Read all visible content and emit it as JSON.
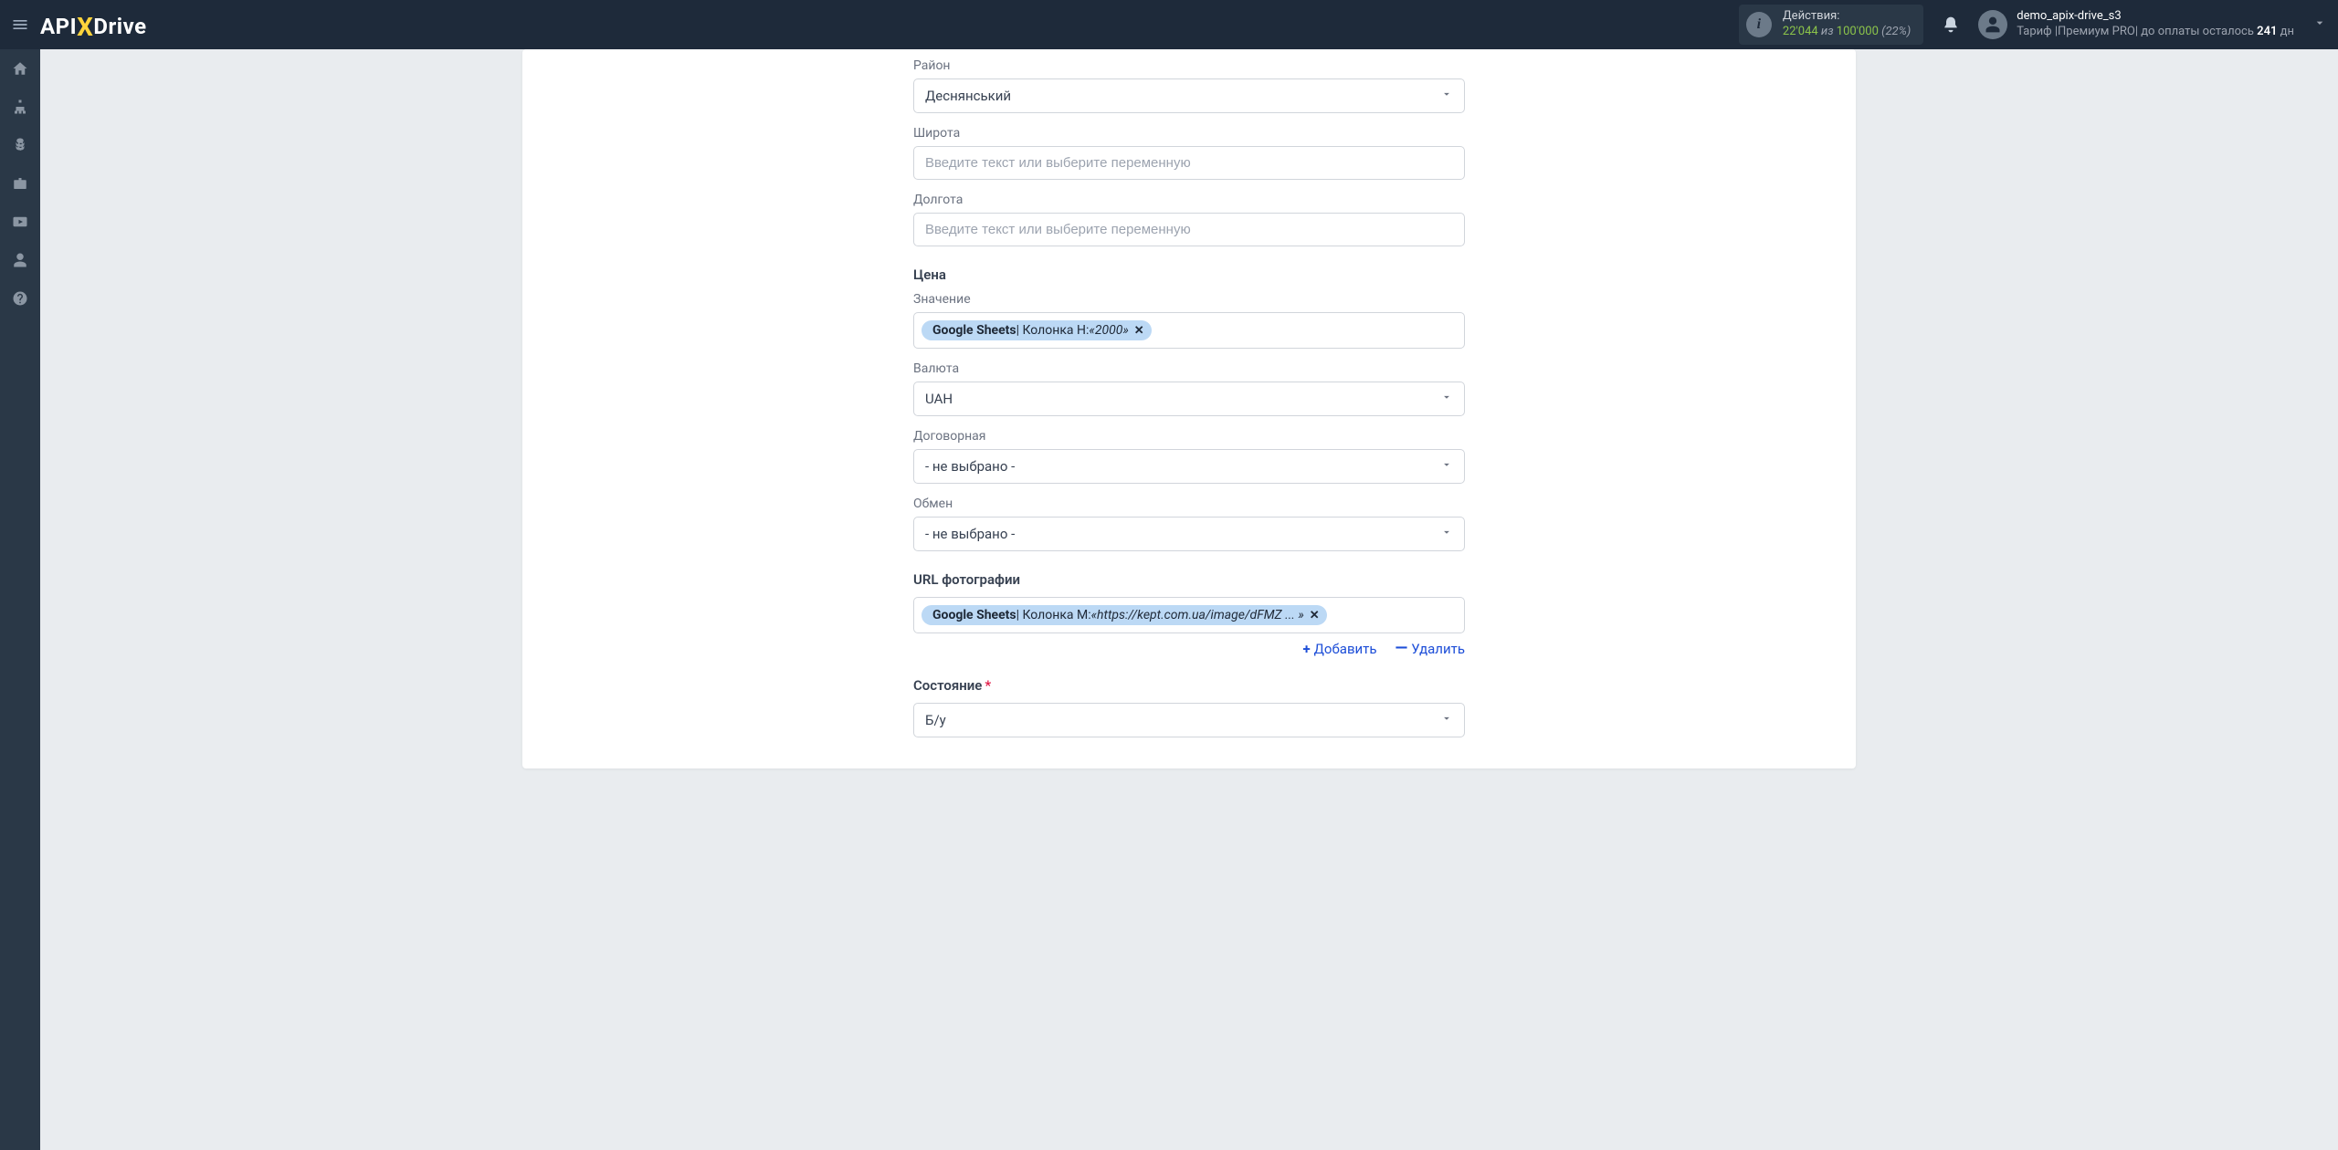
{
  "header": {
    "actions_label": "Действия:",
    "actions_current": "22'044",
    "actions_of": " из ",
    "actions_max": "100'000",
    "actions_pct": "(22%)",
    "user_name": "demo_apix-drive_s3",
    "tariff_prefix": "Тариф |",
    "tariff_name": "Премиум PRO",
    "tariff_mid": "| до оплаты осталось ",
    "tariff_days": "241",
    "tariff_suffix": " дн"
  },
  "form": {
    "district_label": "Район",
    "district_value": "Деснянський",
    "lat_label": "Широта",
    "lat_placeholder": "Введите текст или выберите переменную",
    "lon_label": "Долгота",
    "lon_placeholder": "Введите текст или выберите переменную",
    "price_section": "Цена",
    "value_label": "Значение",
    "value_tag_src": "Google Sheets",
    "value_tag_col": " | Колонка H: ",
    "value_tag_val": "«2000»",
    "currency_label": "Валюта",
    "currency_value": "UAH",
    "negotiable_label": "Договорная",
    "negotiable_value": "- не выбрано -",
    "exchange_label": "Обмен",
    "exchange_value": "- не выбрано -",
    "photo_section": "URL фотографии",
    "photo_tag_src": "Google Sheets",
    "photo_tag_col": " | Колонка M: ",
    "photo_tag_val": "«https://kept.com.ua/image/dFMZ ... »",
    "add_label": "Добавить",
    "delete_label": "Удалить",
    "condition_label": "Состояние",
    "condition_value": "Б/у"
  }
}
